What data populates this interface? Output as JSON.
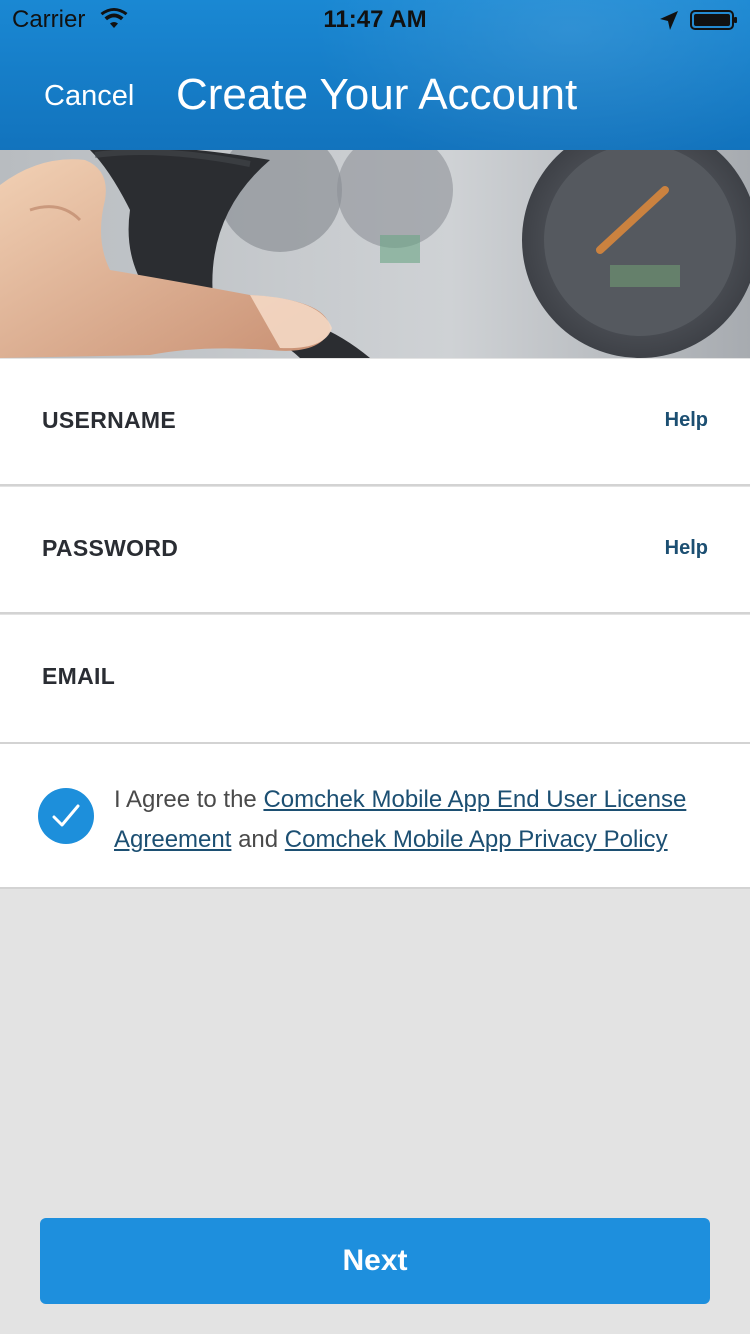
{
  "status_bar": {
    "carrier": "Carrier",
    "time": "11:47 AM",
    "wifi_icon": "wifi-icon",
    "location_icon": "location-arrow-icon",
    "battery_icon": "battery-full-icon"
  },
  "nav": {
    "cancel_label": "Cancel",
    "title": "Create Your Account"
  },
  "hero": {
    "image": "hand-on-steering-wheel-photo"
  },
  "form": {
    "username": {
      "label": "USERNAME",
      "help_label": "Help",
      "value": ""
    },
    "password": {
      "label": "PASSWORD",
      "help_label": "Help",
      "value": ""
    },
    "email": {
      "label": "EMAIL",
      "value": ""
    }
  },
  "agreement": {
    "checked": true,
    "prefix": "I Agree to the ",
    "eula_link": "Comchek Mobile App End User License Agreement",
    "conjunction": " and ",
    "privacy_link": "Comchek Mobile App Privacy Policy"
  },
  "next_button_label": "Next",
  "colors": {
    "header_blue": "#1a88d3",
    "accent_blue": "#1e8fdd",
    "link_color": "#1c4f72",
    "background_gray": "#e3e3e3"
  }
}
